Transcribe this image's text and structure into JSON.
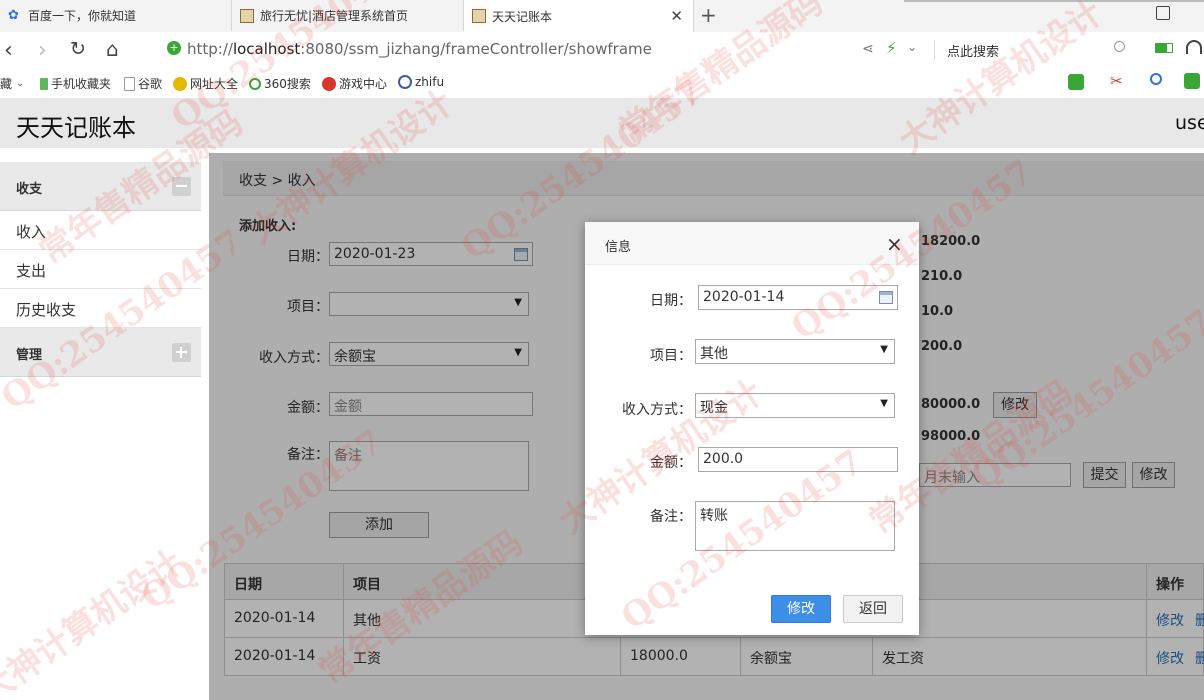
{
  "browser": {
    "tabs": [
      {
        "title": "百度一下，你就知道",
        "color": "#2f6fe4"
      },
      {
        "title": "旅行无忧|酒店管理系统首页",
        "color": "#c49a58"
      },
      {
        "title": "天天记账本",
        "color": "#c49a58"
      }
    ],
    "new_tab": "+",
    "url_prefix": "http://",
    "url_host": "localhost",
    "url_rest": ":8080/ssm_jizhang/frameController/showframe",
    "search_hint": "点此搜索",
    "bookmarks": [
      {
        "label": "收藏",
        "color": "#f2b534"
      },
      {
        "label": "手机收藏夹",
        "color": "#5cb85c"
      },
      {
        "label": "谷歌",
        "color": "#9aa0a6"
      },
      {
        "label": "网址大全",
        "color": "#e6b800"
      },
      {
        "label": "360搜索",
        "color": "#3aa635"
      },
      {
        "label": "游戏中心",
        "color": "#d9362b"
      },
      {
        "label": "zhifu",
        "color": "#3b5ba8"
      }
    ]
  },
  "app": {
    "title": "天天记账本",
    "user_short": "use"
  },
  "sidebar": {
    "group1": "收支",
    "items": [
      "收入",
      "支出",
      "历史收支"
    ],
    "group2": "管理"
  },
  "breadcrumb": "收支 > 收入",
  "form": {
    "heading": "添加收入:",
    "date_label": "日期：",
    "date_value": "2020-01-23",
    "item_label": "项目：",
    "item_value": "",
    "method_label": "收入方式：",
    "method_value": "余额宝",
    "amount_label": "金额：",
    "amount_placeholder": "金额",
    "note_label": "备注：",
    "note_placeholder": "备注",
    "add_button": "添加"
  },
  "summary": {
    "values": [
      "18200.0",
      "210.0",
      "10.0",
      "200.0",
      "80000.0",
      "98000.0"
    ],
    "edit_button_1": "修改",
    "month_placeholder": "月末输入",
    "submit_button": "提交",
    "edit_button_2": "修改"
  },
  "table": {
    "headers": [
      "日期",
      "项目",
      "",
      "",
      "",
      "操作"
    ],
    "rows": [
      {
        "date": "2020-01-14",
        "item": "其他",
        "amount": "",
        "method": "",
        "note": "",
        "edit": "修改",
        "del": "删"
      },
      {
        "date": "2020-01-14",
        "item": "工资",
        "amount": "18000.0",
        "method": "余额宝",
        "note": "发工资",
        "edit": "修改",
        "del": "删"
      }
    ]
  },
  "dialog": {
    "title": "信息",
    "close": "×",
    "date_label": "日期：",
    "date_value": "2020-01-14",
    "item_label": "项目：",
    "item_value": "其他",
    "method_label": "收入方式：",
    "method_value": "现金",
    "amount_label": "金额：",
    "amount_value": "200.0",
    "note_label": "备注：",
    "note_value": "转账",
    "confirm_button": "修改",
    "back_button": "返回",
    "accent": "#3c8ee6"
  },
  "watermarks": [
    "QQ:254540457",
    "大神计算机设计",
    "常年售精品源码"
  ]
}
